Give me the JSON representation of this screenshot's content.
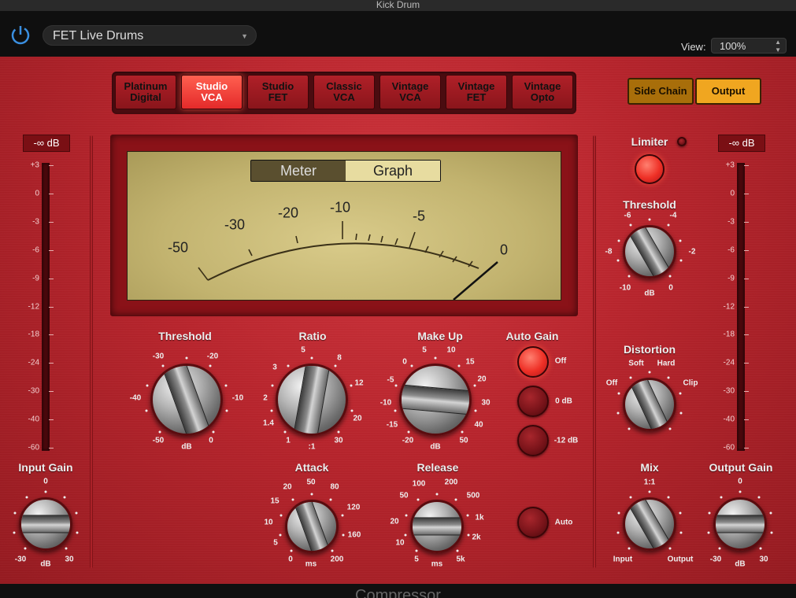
{
  "window": {
    "title": "Kick Drum"
  },
  "header": {
    "preset_name": "FET Live Drums",
    "view_label": "View:",
    "view_value": "100%"
  },
  "modes": [
    {
      "label": "Platinum\nDigital",
      "active": false
    },
    {
      "label": "Studio\nVCA",
      "active": true
    },
    {
      "label": "Studio\nFET",
      "active": false
    },
    {
      "label": "Classic\nVCA",
      "active": false
    },
    {
      "label": "Vintage\nVCA",
      "active": false
    },
    {
      "label": "Vintage\nFET",
      "active": false
    },
    {
      "label": "Vintage\nOpto",
      "active": false
    }
  ],
  "right_buttons": {
    "side_chain": "Side Chain",
    "output": "Output"
  },
  "meter": {
    "tab_meter": "Meter",
    "tab_graph": "Graph",
    "scale_labels": [
      "-50",
      "-30",
      "-20",
      "-10",
      "-5",
      "0"
    ]
  },
  "input_meter": {
    "readout": "-∞ dB",
    "scale": [
      "+3",
      "0",
      "-3",
      "-6",
      "-9",
      "-12",
      "-18",
      "-24",
      "-30",
      "-40",
      "-60"
    ]
  },
  "output_meter": {
    "readout": "-∞ dB",
    "scale": [
      "+3",
      "0",
      "-3",
      "-6",
      "-9",
      "-12",
      "-18",
      "-24",
      "-30",
      "-40",
      "-60"
    ]
  },
  "knobs": {
    "threshold": {
      "label": "Threshold",
      "ticks": [
        "-30",
        "-20",
        "-40",
        "-10",
        "-50",
        "dB",
        "0"
      ]
    },
    "ratio": {
      "label": "Ratio",
      "ticks": [
        "5",
        "3",
        "8",
        "2",
        "12",
        "1.4",
        "20",
        "1",
        ":1",
        "30"
      ]
    },
    "makeup": {
      "label": "Make Up",
      "ticks": [
        "5",
        "10",
        "0",
        "15",
        "-5",
        "20",
        "-10",
        "30",
        "-15",
        "40",
        "-20",
        "dB",
        "50"
      ]
    },
    "attack": {
      "label": "Attack",
      "ticks": [
        "20",
        "50",
        "80",
        "15",
        "120",
        "10",
        "5",
        "160",
        "0",
        "ms",
        "200"
      ]
    },
    "release": {
      "label": "Release",
      "ticks": [
        "100",
        "200",
        "50",
        "500",
        "20",
        "1k",
        "10",
        "2k",
        "5",
        "ms",
        "5k"
      ]
    },
    "input_gain": {
      "label": "Input Gain",
      "ticks": [
        "0",
        "-30",
        "dB",
        "30"
      ]
    },
    "limiter_threshold": {
      "label": "Threshold",
      "ticks": [
        "-6",
        "-4",
        "-8",
        "-2",
        "-10",
        "dB",
        "0"
      ]
    },
    "distortion": {
      "label": "Distortion",
      "ticks": [
        "Soft",
        "Hard",
        "Off",
        "Clip"
      ]
    },
    "mix": {
      "label": "Mix",
      "ticks": [
        "1:1",
        "Input",
        "Output"
      ]
    },
    "output_gain": {
      "label": "Output Gain",
      "ticks": [
        "0",
        "-30",
        "dB",
        "30"
      ]
    }
  },
  "auto_gain": {
    "label": "Auto Gain",
    "options": [
      "Off",
      "0 dB",
      "-12 dB"
    ],
    "selected": "Off"
  },
  "auto_release": {
    "label": "Auto"
  },
  "limiter": {
    "label": "Limiter"
  },
  "footer": {
    "title": "Compressor"
  }
}
